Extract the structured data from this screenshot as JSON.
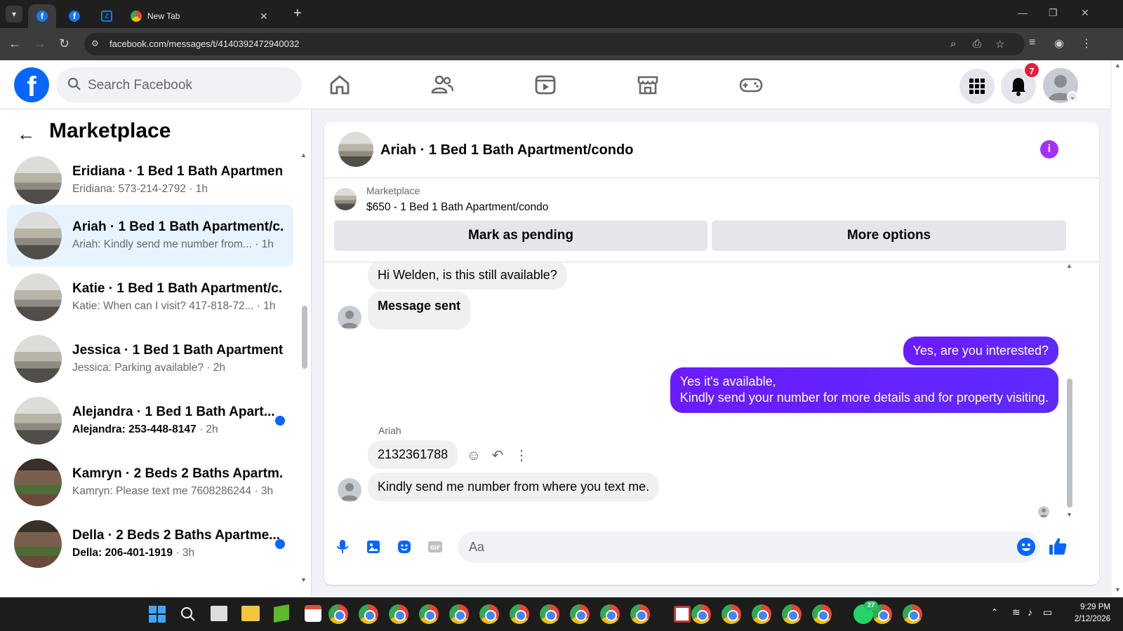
{
  "browser": {
    "tabs": [
      {
        "label": "",
        "icon": "facebook-icon",
        "active": true
      },
      {
        "label": "",
        "icon": "facebook-icon",
        "active": false
      },
      {
        "label": "",
        "icon": "zillow-icon",
        "active": false
      },
      {
        "label": "New Tab",
        "icon": "chrome-icon",
        "active": false
      }
    ],
    "url": "facebook.com/messages/t/4140392472940032"
  },
  "header": {
    "search_placeholder": "Search Facebook",
    "notification_count": "7"
  },
  "marketplace": {
    "title": "Marketplace",
    "conversations": [
      {
        "name": "Eridiana · 1 Bed 1 Bath Apartmen...",
        "preview": "Eridiana: 573-214-2792",
        "time": " · 1h",
        "unread": false,
        "thumb": "room"
      },
      {
        "name": "Ariah · 1 Bed 1 Bath Apartment/c...",
        "preview": "Ariah: Kindly send me number from...",
        "time": " · 1h",
        "unread": false,
        "thumb": "room"
      },
      {
        "name": "Katie · 1 Bed 1 Bath Apartment/c...",
        "preview": "Katie: When can I visit? 417-818-72...",
        "time": " · 1h",
        "unread": false,
        "thumb": "room"
      },
      {
        "name": "Jessica · 1 Bed 1 Bath Apartment/...",
        "preview": "Jessica: Parking available?",
        "time": " · 2h",
        "unread": false,
        "thumb": "room"
      },
      {
        "name": "Alejandra · 1 Bed 1 Bath Apart...",
        "preview": "Alejandra: 253-448-8147",
        "time": " · 2h",
        "unread": true,
        "thumb": "room"
      },
      {
        "name": "Kamryn · 2 Beds 2 Baths Apartm...",
        "preview": "Kamryn: Please text me 7608286244",
        "time": " · 3h",
        "unread": false,
        "thumb": "patio"
      },
      {
        "name": "Della · 2 Beds 2 Baths Apartme...",
        "preview": "Della: 206-401-1919",
        "time": " · 3h",
        "unread": true,
        "thumb": "patio"
      }
    ]
  },
  "chat": {
    "title": "Ariah · 1 Bed 1 Bath Apartment/condo",
    "listing_label": "Marketplace",
    "listing_price": "$650 - 1 Bed 1 Bath Apartment/condo",
    "mark_pending": "Mark as pending",
    "more_options": "More options",
    "messages": {
      "m1": "Hi Welden, is this still available?",
      "m2": "Message sent",
      "m3": "Yes, are you interested?",
      "m4_line1": "Yes it's available,",
      "m4_line2": "Kindly send your number for more details and for property visiting.",
      "sender": "Ariah",
      "m5": "2132361788",
      "m6": "Kindly send me number from where you text me."
    },
    "composer_placeholder": "Aa"
  },
  "taskbar": {
    "time": "9:29 PM",
    "date": "2/12/2026",
    "whatsapp_badge": "27"
  },
  "colors": {
    "fb_blue": "#0866ff",
    "outgoing_bubble": "#6a1bff",
    "incoming_bubble": "#f0f0f0",
    "notification_red": "#e41e3f"
  }
}
